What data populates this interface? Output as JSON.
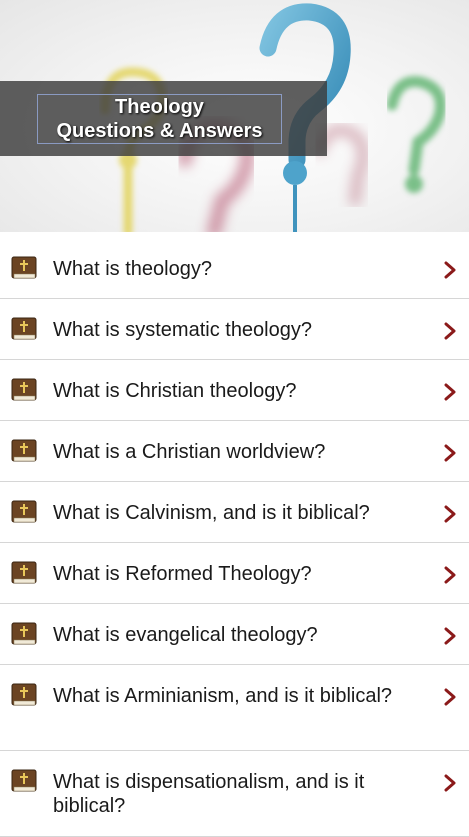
{
  "banner": {
    "title_line1": "Theology",
    "title_line2": "Questions & Answers"
  },
  "icons": {
    "row_icon": "bible-book-icon",
    "row_arrow": "chevron-right-icon"
  },
  "colors": {
    "chevron": "#8b1a1a",
    "divider": "#d6d6d6",
    "text": "#1a1a1a"
  },
  "questions": [
    "What is theology?",
    "What is systematic theology?",
    "What is Christian theology?",
    "What is a Christian worldview?",
    "What is Calvinism, and is it biblical?",
    "What is Reformed Theology?",
    "What is evangelical theology?",
    "What is Arminianism, and is it biblical?",
    "What is dispensationalism, and is it biblical?"
  ]
}
